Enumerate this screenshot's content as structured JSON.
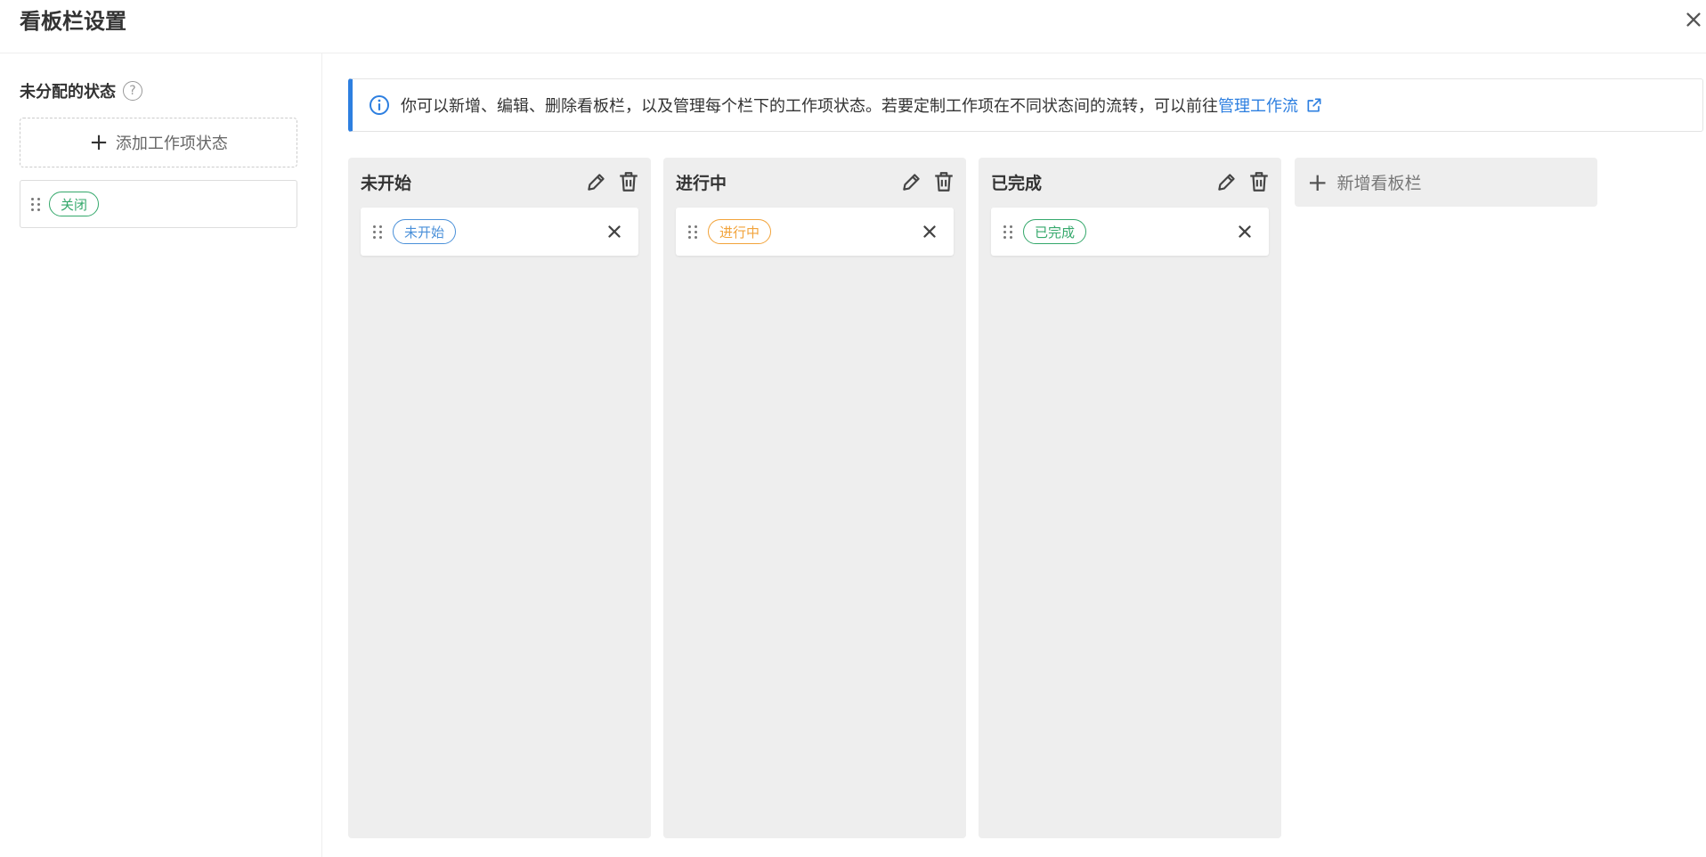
{
  "dialog": {
    "title": "看板栏设置"
  },
  "left": {
    "heading": "未分配的状态",
    "help_symbol": "?",
    "add_button_label": "添加工作项状态",
    "items": [
      {
        "label": "关闭",
        "color": "#34a86b"
      }
    ]
  },
  "info": {
    "text": "你可以新增、编辑、删除看板栏，以及管理每个栏下的工作项状态。若要定制工作项在不同状态间的流转，可以前往",
    "link": "管理工作流"
  },
  "columns": [
    {
      "title": "未开始",
      "status": "未开始",
      "color": "#4a90d9"
    },
    {
      "title": "进行中",
      "status": "进行中",
      "color": "#f2a33a"
    },
    {
      "title": "已完成",
      "status": "已完成",
      "color": "#34a86b"
    }
  ],
  "add_column_label": "新增看板栏",
  "colors": {
    "accent": "#2d7fe0",
    "column_bg": "#eeeeee"
  },
  "icons": [
    "close-icon",
    "help-icon",
    "plus-icon",
    "drag-handle-icon",
    "info-icon",
    "external-link-icon",
    "edit-icon",
    "trash-icon",
    "remove-icon"
  ]
}
